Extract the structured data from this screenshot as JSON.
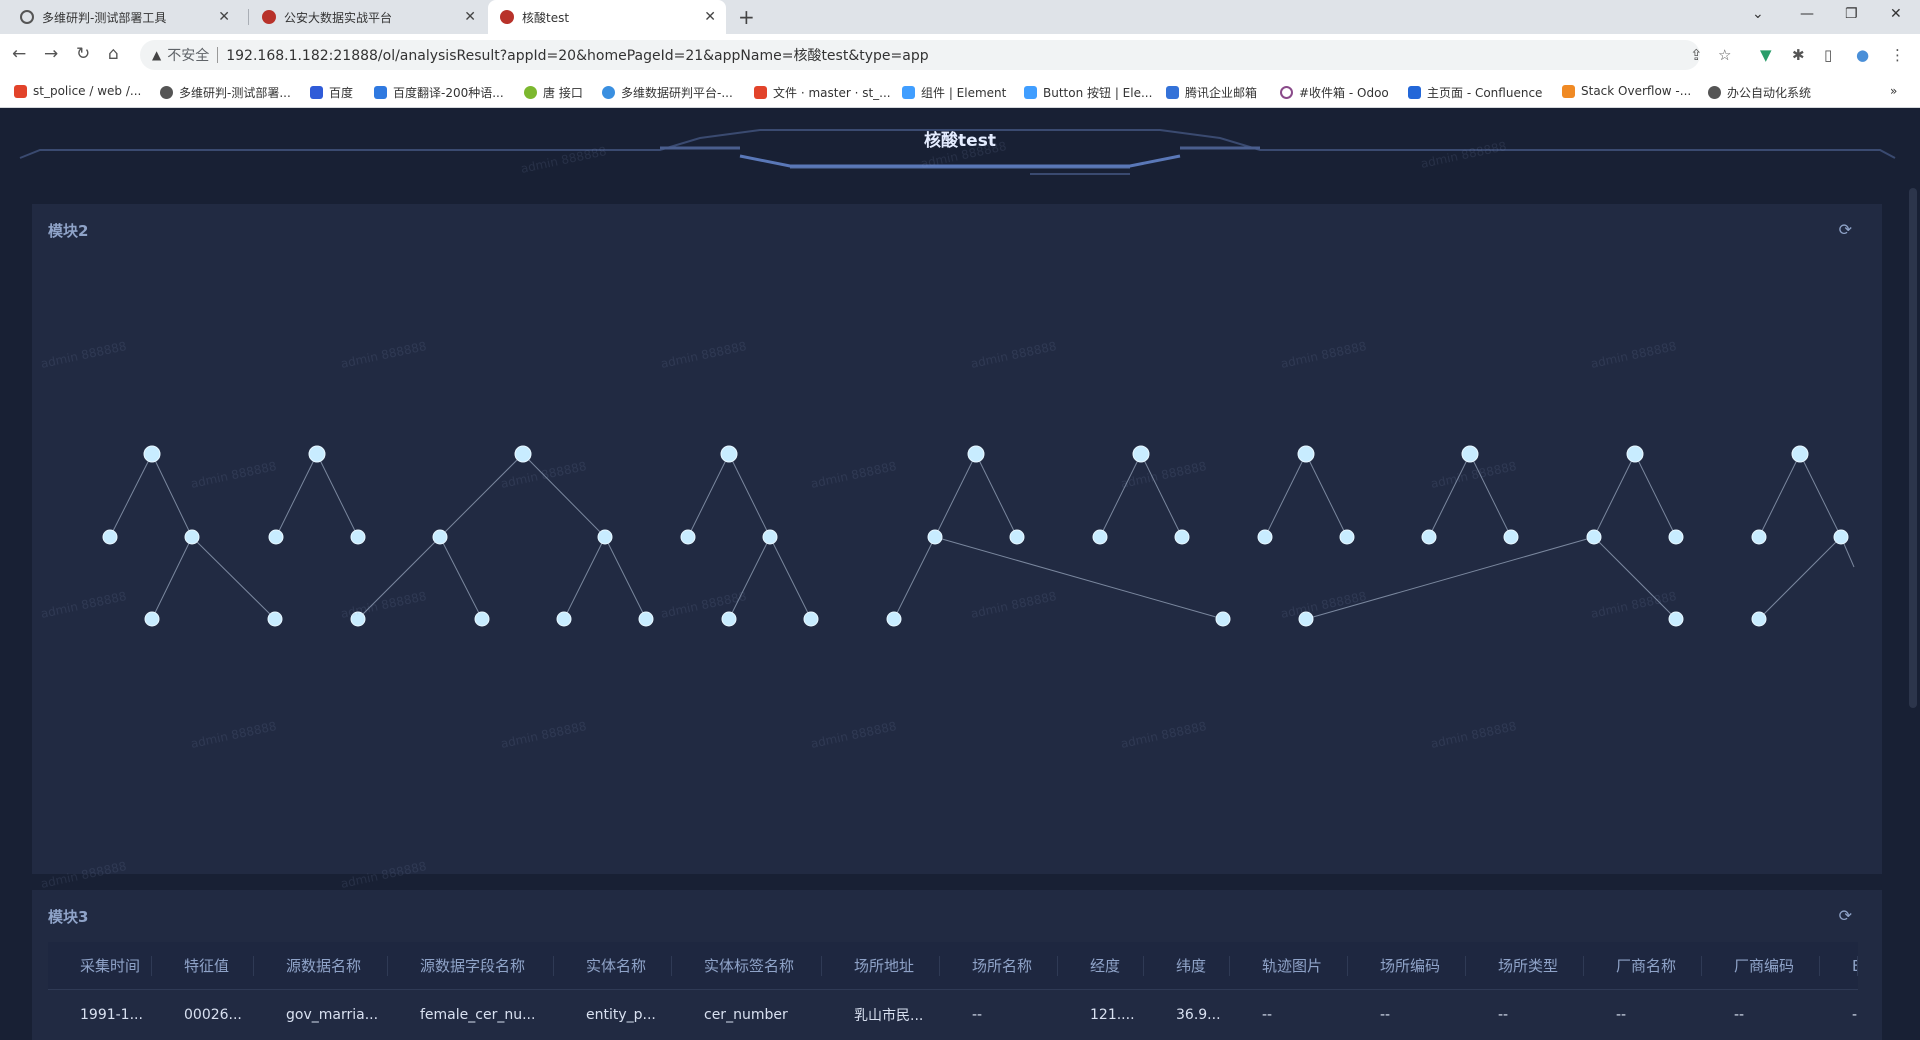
{
  "browser": {
    "tabs": [
      {
        "title": "多维研判-测试部署工具",
        "active": false
      },
      {
        "title": "公安大数据实战平台",
        "active": false
      },
      {
        "title": "核酸test",
        "active": true
      }
    ],
    "new_tab": "+",
    "address": {
      "security_label": "不安全",
      "url": "192.168.1.182:21888/ol/analysisResult?appId=20&homePageId=21&appName=核酸test&type=app"
    },
    "bookmarks": [
      "st_police / web /...",
      "多维研判-测试部署...",
      "百度",
      "百度翻译-200种语...",
      "唐 接口",
      "多维数据研判平台-...",
      "文件 · master · st_...",
      "组件 | Element",
      "Button 按钮 | Ele...",
      "腾讯企业邮箱",
      "#收件箱 - Odoo",
      "主页面 - Confluence",
      "Stack Overflow -...",
      "办公自动化系统"
    ],
    "bookmarks_more": "»"
  },
  "page": {
    "title": "核酸test",
    "watermark": "admin 888888"
  },
  "module2": {
    "title": "模块2",
    "refresh_icon": "refresh-icon"
  },
  "module3": {
    "title": "模块3",
    "refresh_icon": "refresh-icon",
    "columns": [
      "采集时间",
      "特征值",
      "源数据名称",
      "源数据字段名称",
      "实体名称",
      "实体标签名称",
      "场所地址",
      "场所名称",
      "经度",
      "纬度",
      "轨迹图片",
      "场所编码",
      "场所类型",
      "厂商名称",
      "厂商编码",
      "E"
    ],
    "rows": [
      [
        "1991-1...",
        "00026...",
        "gov_marria...",
        "female_cer_nu...",
        "entity_p...",
        "cer_number",
        "乳山市民...",
        "--",
        "121....",
        "36.9...",
        "--",
        "--",
        "--",
        "--",
        "--",
        "-"
      ]
    ]
  },
  "colors": {
    "page_bg": "#182034",
    "panel_bg": "#212a42",
    "node": "#c8ecff",
    "title": "#e4ecff"
  }
}
